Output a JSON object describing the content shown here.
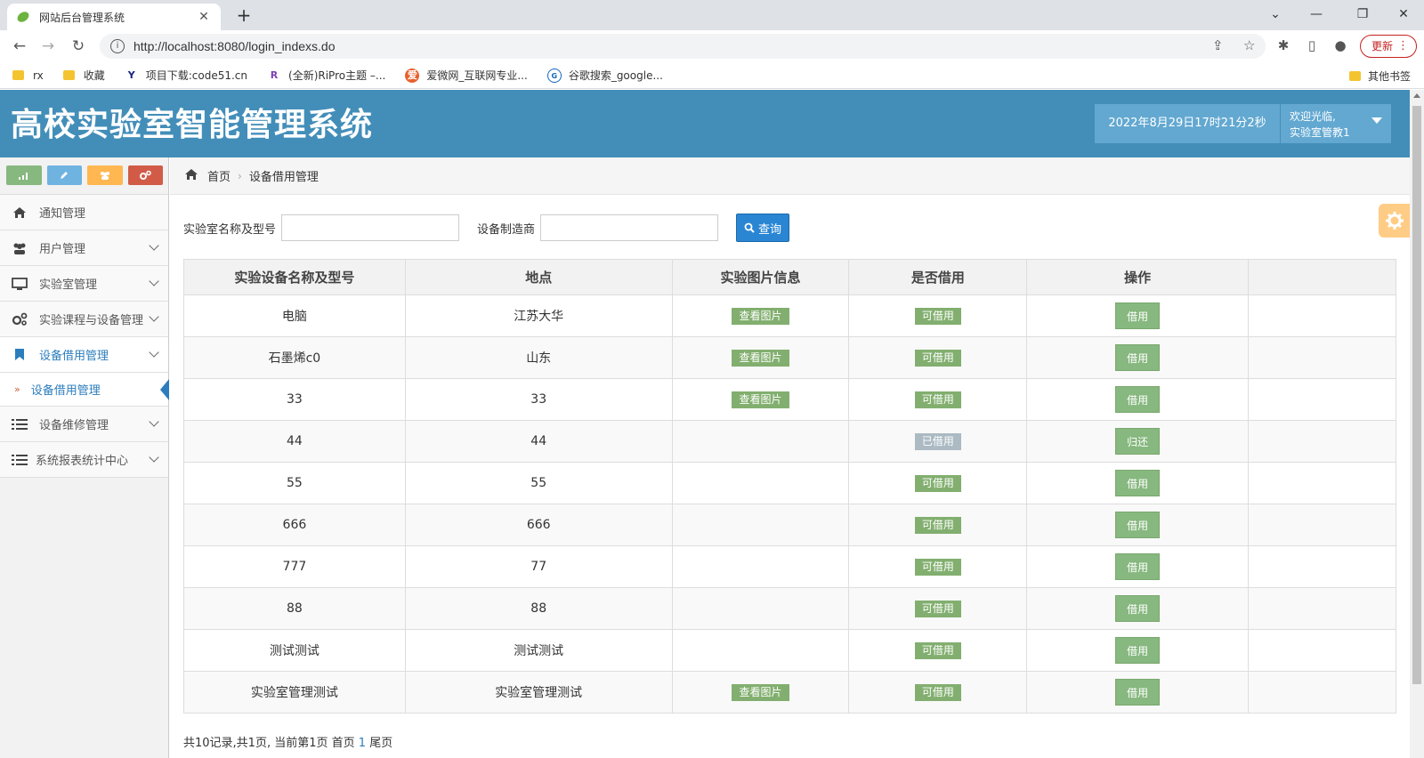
{
  "browser": {
    "tab_title": "网站后台管理系统",
    "url": "http://localhost:8080/login_indexs.do",
    "update_label": "更新",
    "bookmarks": [
      {
        "label": "rx"
      },
      {
        "label": "收藏"
      },
      {
        "label": "项目下载:code51.cn"
      },
      {
        "label": "(全新)RiPro主题 –..."
      },
      {
        "label": "爱微网_互联网专业..."
      },
      {
        "label": "谷歌搜索_google..."
      }
    ],
    "other_bookmarks": "其他书签"
  },
  "header": {
    "title": "高校实验室智能管理系统",
    "datetime": "2022年8月29日17时21分2秒",
    "welcome": "欢迎光临,",
    "username": "实验室管教1"
  },
  "sidebar": {
    "items": [
      {
        "label": "通知管理"
      },
      {
        "label": "用户管理"
      },
      {
        "label": "实验室管理"
      },
      {
        "label": "实验课程与设备管理"
      },
      {
        "label": "设备借用管理"
      },
      {
        "label": "设备维修管理"
      },
      {
        "label": "系统报表统计中心"
      }
    ],
    "active_sub": "设备借用管理"
  },
  "breadcrumb": {
    "home": "首页",
    "current": "设备借用管理"
  },
  "search": {
    "label1": "实验室名称及型号",
    "label2": "设备制造商",
    "value1": "",
    "value2": "",
    "button": "查询"
  },
  "table": {
    "columns": [
      "实验设备名称及型号",
      "地点",
      "实验图片信息",
      "是否借用",
      "操作",
      ""
    ],
    "rows": [
      {
        "name": "电脑",
        "location": "江苏大华",
        "image": "查看图片",
        "status": "可借用",
        "action": "借用"
      },
      {
        "name": "石墨烯c0",
        "location": "山东",
        "image": "查看图片",
        "status": "可借用",
        "action": "借用"
      },
      {
        "name": "33",
        "location": "33",
        "image": "查看图片",
        "status": "可借用",
        "action": "借用"
      },
      {
        "name": "44",
        "location": "44",
        "image": "",
        "status": "已借用",
        "action": "归还"
      },
      {
        "name": "55",
        "location": "55",
        "image": "",
        "status": "可借用",
        "action": "借用"
      },
      {
        "name": "666",
        "location": "666",
        "image": "",
        "status": "可借用",
        "action": "借用"
      },
      {
        "name": "777",
        "location": "77",
        "image": "",
        "status": "可借用",
        "action": "借用"
      },
      {
        "name": "88",
        "location": "88",
        "image": "",
        "status": "可借用",
        "action": "借用"
      },
      {
        "name": "测试测试",
        "location": "测试测试",
        "image": "",
        "status": "可借用",
        "action": "借用"
      },
      {
        "name": "实验室管理测试",
        "location": "实验室管理测试",
        "image": "查看图片",
        "status": "可借用",
        "action": "借用"
      }
    ]
  },
  "pager": {
    "summary": "共10记录,共1页, 当前第1页 首页",
    "current": "1",
    "last": "尾页"
  },
  "colors": {
    "header_bg": "#438eb9",
    "tag_green": "#82af6f",
    "tag_gray": "#abbac3",
    "button_green": "#87b87f",
    "query_blue": "#2a86d3"
  }
}
